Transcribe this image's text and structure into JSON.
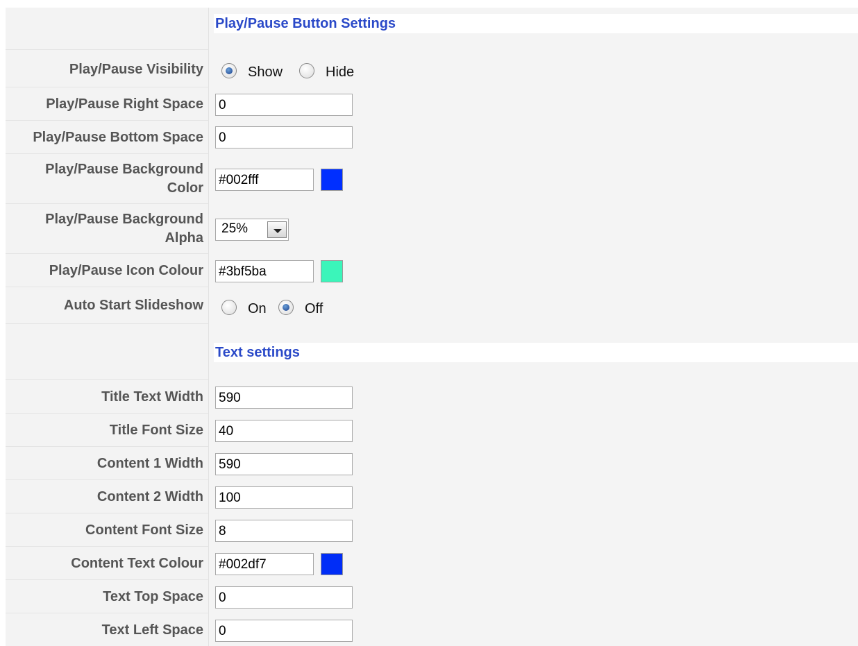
{
  "sections": {
    "playpause_title": "Play/Pause Button Settings",
    "text_title": "Text settings"
  },
  "playpause": {
    "visibility": {
      "label": "Play/Pause Visibility",
      "options": [
        "Show",
        "Hide"
      ],
      "selected": "Show"
    },
    "right_space": {
      "label": "Play/Pause Right Space",
      "value": "0"
    },
    "bottom_space": {
      "label": "Play/Pause Bottom Space",
      "value": "0"
    },
    "bg_color": {
      "label_line1": "Play/Pause Background",
      "label_line2": "Color",
      "value": "#002fff",
      "swatch": "#002fff"
    },
    "bg_alpha": {
      "label_line1": "Play/Pause Background",
      "label_line2": "Alpha",
      "value": "25%"
    },
    "icon_colour": {
      "label": "Play/Pause Icon Colour",
      "value": "#3bf5ba",
      "swatch": "#3bf5ba"
    },
    "auto_start": {
      "label": "Auto Start Slideshow",
      "options": [
        "On",
        "Off"
      ],
      "selected": "Off"
    }
  },
  "text": {
    "title_width": {
      "label": "Title Text Width",
      "value": "590"
    },
    "title_font": {
      "label": "Title Font Size",
      "value": "40"
    },
    "content1_width": {
      "label": "Content 1 Width",
      "value": "590"
    },
    "content2_width": {
      "label": "Content 2 Width",
      "value": "100"
    },
    "content_font": {
      "label": "Content Font Size",
      "value": "8"
    },
    "content_colour": {
      "label": "Content Text Colour",
      "value": "#002df7",
      "swatch": "#002df7"
    },
    "top_space": {
      "label": "Text Top Space",
      "value": "0"
    },
    "left_space": {
      "label": "Text Left Space",
      "value": "0"
    }
  }
}
